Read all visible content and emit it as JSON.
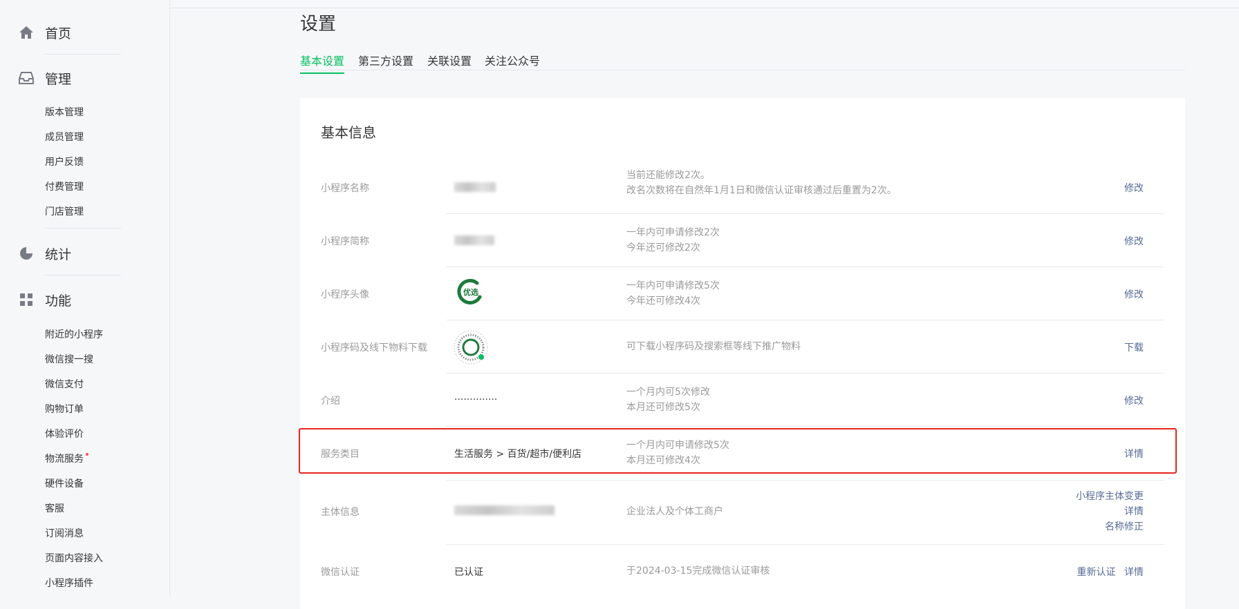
{
  "sidebar": {
    "home": {
      "label": "首页",
      "icon": "home-icon"
    },
    "manage": {
      "label": "管理",
      "icon": "inbox-icon",
      "items": [
        "版本管理",
        "成员管理",
        "用户反馈",
        "付费管理",
        "门店管理"
      ]
    },
    "stats": {
      "label": "统计",
      "icon": "pie-chart-icon"
    },
    "features": {
      "label": "功能",
      "icon": "grid-icon",
      "items": [
        "附近的小程序",
        "微信搜一搜",
        "微信支付",
        "购物订单",
        "体验评价",
        "物流服务",
        "硬件设备",
        "客服",
        "订阅消息",
        "页面内容接入",
        "小程序插件"
      ]
    }
  },
  "page": {
    "title": "设置",
    "tabs": [
      "基本设置",
      "第三方设置",
      "关联设置",
      "关注公众号"
    ],
    "active_tab": "基本设置"
  },
  "card": {
    "title": "基本信息",
    "rows": [
      {
        "label": "小程序名称",
        "value": "",
        "desc1": "当前还能修改2次。",
        "desc2": "改名次数将在自然年1月1日和微信认证审核通过后重置为2次。",
        "actions": [
          "修改"
        ]
      },
      {
        "label": "小程序简称",
        "value": "",
        "desc1": "一年内可申请修改2次",
        "desc2": "今年还可修改2次",
        "actions": [
          "修改"
        ]
      },
      {
        "label": "小程序头像",
        "value": "优选",
        "desc1": "一年内可申请修改5次",
        "desc2": "今年还可修改4次",
        "actions": [
          "修改"
        ]
      },
      {
        "label": "小程序码及线下物料下载",
        "value": "",
        "desc1": "可下载小程序码及搜索框等线下推广物料",
        "desc2": "",
        "actions": [
          "下载"
        ]
      },
      {
        "label": "介绍",
        "value": "..............",
        "desc1": "一个月内可5次修改",
        "desc2": "本月还可修改5次",
        "actions": [
          "修改"
        ]
      },
      {
        "label": "服务类目",
        "value": "生活服务 > 百货/超市/便利店",
        "desc1": "一个月内可申请修改5次",
        "desc2": "本月还可修改4次",
        "actions": [
          "详情"
        ]
      },
      {
        "label": "主体信息",
        "value": "",
        "desc1": "企业法人及个体工商户",
        "desc2": "",
        "actions": [
          "小程序主体变更",
          "详情",
          "名称修正"
        ]
      },
      {
        "label": "微信认证",
        "value": "已认证",
        "desc1": "于2024-03-15完成微信认证审核",
        "desc2": "",
        "actions": [
          "重新认证",
          "详情"
        ]
      }
    ]
  },
  "colors": {
    "accent": "#07c160",
    "link": "#576b95",
    "highlight": "#e8231c"
  }
}
